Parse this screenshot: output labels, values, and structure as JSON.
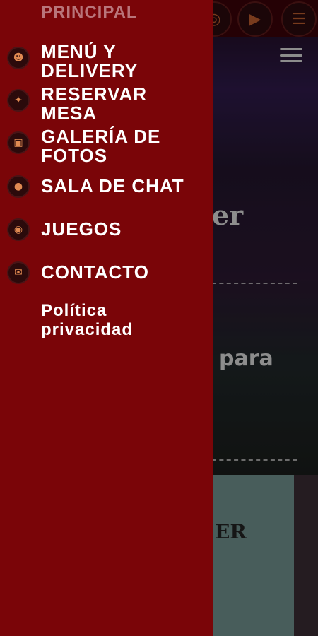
{
  "drawer": {
    "section_title": "PRINCIPAL",
    "items": [
      {
        "label": "MENÚ Y\nDELIVERY",
        "icon": "menu-delivery-icon",
        "glyph": "☻"
      },
      {
        "label": "RESERVAR\nMESA",
        "icon": "reservation-logo-icon",
        "glyph": "✦"
      },
      {
        "label": "GALERÍA DE\nFOTOS",
        "icon": "photo-gallery-icon",
        "glyph": "▣"
      },
      {
        "label": "SALA DE CHAT",
        "icon": "user-chat-icon",
        "glyph": "●"
      },
      {
        "label": "JUEGOS",
        "icon": "games-icon",
        "glyph": "◉"
      },
      {
        "label": "CONTACTO",
        "icon": "envelope-icon",
        "glyph": "✉"
      },
      {
        "label": "Política\nprivacidad",
        "icon": "",
        "glyph": ""
      }
    ]
  },
  "background": {
    "hero_text_1": "er",
    "hero_text_2": "para",
    "card_text": "ER",
    "top_icons": [
      "instagram-icon",
      "play-icon",
      "notes-icon"
    ]
  },
  "colors": {
    "drawer_bg": "#7a0508",
    "section_title": "#b9757a",
    "icon_accent": "#e08a52"
  }
}
